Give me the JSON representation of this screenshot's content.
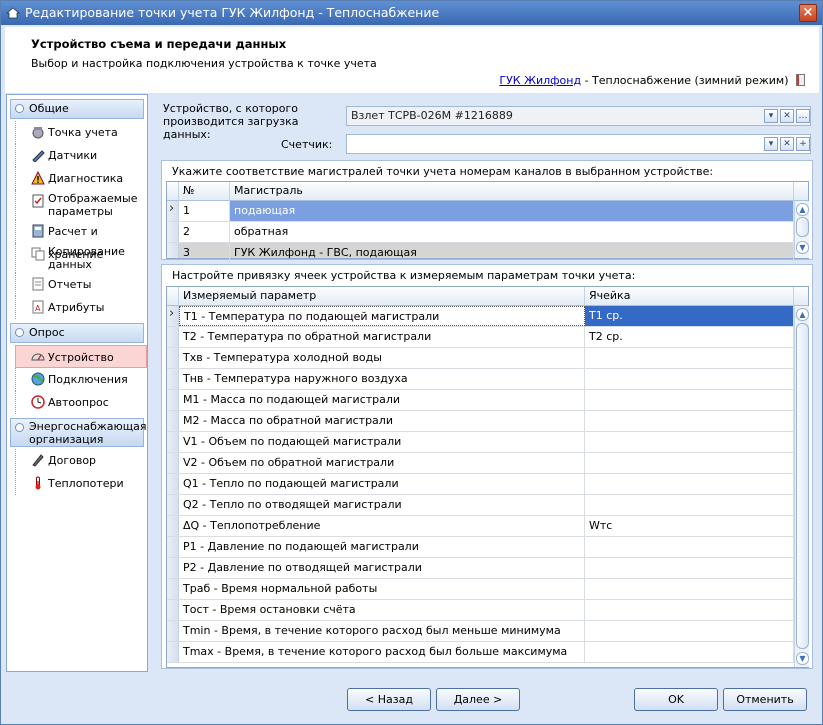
{
  "window": {
    "title": "Редактирование точки учета ГУК Жилфонд - Теплоснабжение",
    "close_glyph": "×"
  },
  "header": {
    "title": "Устройство съема и передачи данных",
    "subtitle": "Выбор и настройка подключения устройства к точке учета",
    "link": "ГУК Жилфонд",
    "link_rest": "- Теплоснабжение (зимний режим)"
  },
  "sidebar": {
    "groups": [
      {
        "label": "Общие",
        "items": [
          {
            "label": "Точка учета",
            "icon": "meter-icon"
          },
          {
            "label": "Датчики",
            "icon": "sensor-icon"
          },
          {
            "label": "Диагностика",
            "icon": "warning-icon"
          },
          {
            "label": "Отображаемые параметры",
            "icon": "checklist-icon"
          },
          {
            "label": "Расчет и хранение",
            "icon": "calculator-icon"
          },
          {
            "label": "Копирование данных",
            "icon": "copy-icon"
          },
          {
            "label": "Отчеты",
            "icon": "report-icon"
          },
          {
            "label": "Атрибуты",
            "icon": "attributes-icon"
          }
        ]
      },
      {
        "label": "Опрос",
        "items": [
          {
            "label": "Устройство",
            "icon": "gauge-icon",
            "selected": true
          },
          {
            "label": "Подключения",
            "icon": "globe-icon"
          },
          {
            "label": "Автоопрос",
            "icon": "clock-icon"
          }
        ]
      },
      {
        "label": "Энергоснабжающая организация",
        "items": [
          {
            "label": "Договор",
            "icon": "pen-icon"
          },
          {
            "label": "Теплопотери",
            "icon": "thermometer-icon"
          }
        ]
      }
    ]
  },
  "device": {
    "label": "Устройство, с которого производится загрузка данных:",
    "value": "Взлет ТСРВ-026М #1216889",
    "counter_label": "Счетчик:",
    "counter_value": ""
  },
  "channels": {
    "caption": "Укажите соответствие магистралей точки учета номерам каналов в выбранном устройстве:",
    "columns": [
      "№",
      "Магистраль"
    ],
    "rows": [
      {
        "num": "1",
        "name": "подающая"
      },
      {
        "num": "2",
        "name": "обратная"
      },
      {
        "num": "3",
        "name": "ГУК Жилфонд - ГВС, подающая"
      }
    ]
  },
  "cells": {
    "caption": "Настройте привязку ячеек устройства к измеряемым параметрам точки учета:",
    "columns": [
      "Измеряемый параметр",
      "Ячейка"
    ],
    "rows": [
      {
        "param": "T1 - Температура по подающей магистрали",
        "cell": "T1 ср."
      },
      {
        "param": "T2 - Температура по обратной магистрали",
        "cell": "T2 ср."
      },
      {
        "param": "Tхв - Температура холодной воды",
        "cell": ""
      },
      {
        "param": "Tнв - Температура наружного воздуха",
        "cell": ""
      },
      {
        "param": "M1 - Масса по подающей магистрали",
        "cell": ""
      },
      {
        "param": "M2 - Масса по обратной магистрали",
        "cell": ""
      },
      {
        "param": "V1 - Объем по подающей магистрали",
        "cell": ""
      },
      {
        "param": "V2 - Объем по обратной магистрали",
        "cell": ""
      },
      {
        "param": "Q1 - Тепло по подающей магистрали",
        "cell": ""
      },
      {
        "param": "Q2 - Тепло по отводящей магистрали",
        "cell": ""
      },
      {
        "param": "ΔQ - Теплопотребление",
        "cell": "Wтс"
      },
      {
        "param": "P1 - Давление по подающей магистрали",
        "cell": ""
      },
      {
        "param": "P2 - Давление по отводящей магистрали",
        "cell": ""
      },
      {
        "param": "Траб - Время нормальной работы",
        "cell": ""
      },
      {
        "param": "Тост - Время остановки счёта",
        "cell": ""
      },
      {
        "param": "Tmin - Время, в течение которого расход был меньше минимума",
        "cell": ""
      },
      {
        "param": "Tmax - Время, в течение которого расход был больше максимума",
        "cell": ""
      }
    ]
  },
  "buttons": {
    "back": "< Назад",
    "next": "Далее >",
    "ok": "OK",
    "cancel": "Отменить"
  }
}
